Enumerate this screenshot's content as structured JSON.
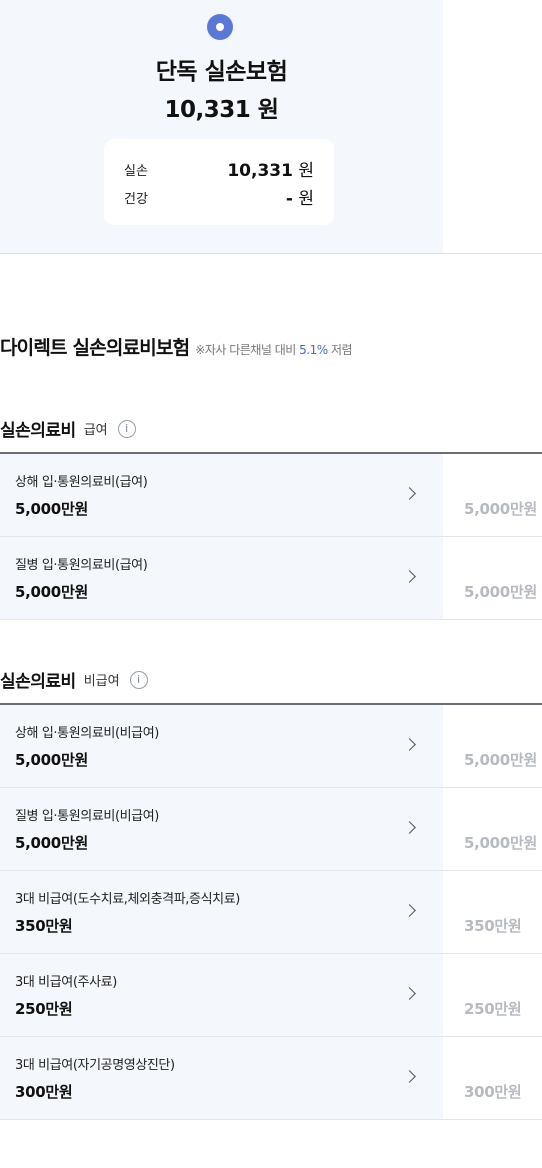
{
  "plan": {
    "name": "단독 실손보험",
    "price": "10,331 원",
    "summary": [
      {
        "label": "실손",
        "amount": "10,331",
        "unit": " 원"
      },
      {
        "label": "건강",
        "amount": "-",
        "unit": " 원"
      }
    ]
  },
  "product": {
    "name": "다이렉트 실손의료비보험",
    "note_prefix": "※자사 다른채널 대비 ",
    "note_pct": "5.1%",
    "note_suffix": " 저렴"
  },
  "sections": [
    {
      "title": "실손의료비",
      "subtitle": "급여",
      "info_icon": "i",
      "rows": [
        {
          "title": "상해 입·통원의료비(급여)",
          "amount": "5,000만원",
          "compare": "5,000만원"
        },
        {
          "title": "질병 입·통원의료비(급여)",
          "amount": "5,000만원",
          "compare": "5,000만원"
        }
      ]
    },
    {
      "title": "실손의료비",
      "subtitle": "비급여",
      "info_icon": "i",
      "rows": [
        {
          "title": "상해 입·통원의료비(비급여)",
          "amount": "5,000만원",
          "compare": "5,000만원"
        },
        {
          "title": "질병 입·통원의료비(비급여)",
          "amount": "5,000만원",
          "compare": "5,000만원"
        },
        {
          "title": "3대 비급여(도수치료,체외충격파,증식치료)",
          "amount": "350만원",
          "compare": "350만원"
        },
        {
          "title": "3대 비급여(주사료)",
          "amount": "250만원",
          "compare": "250만원"
        },
        {
          "title": "3대 비급여(자기공명영상진단)",
          "amount": "300만원",
          "compare": "300만원"
        }
      ]
    }
  ]
}
